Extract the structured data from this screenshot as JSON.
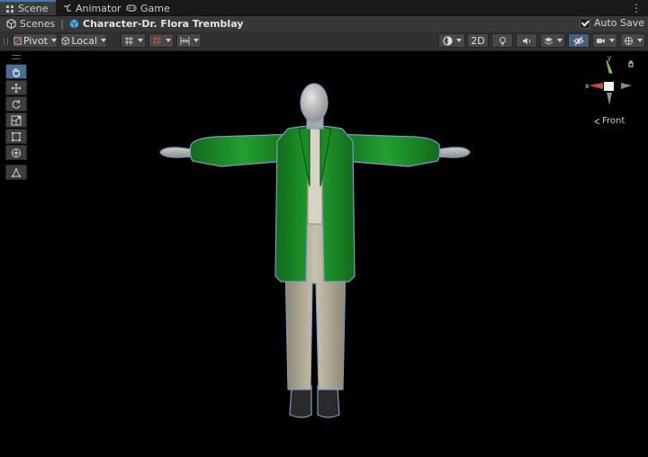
{
  "tabs": [
    {
      "label": "Scene",
      "icon": "grid-icon",
      "active": true
    },
    {
      "label": "Animator",
      "icon": "animator-icon",
      "active": false
    },
    {
      "label": "Game",
      "icon": "gamepad-icon",
      "active": false
    }
  ],
  "breadcrumb": {
    "root": "Scenes",
    "object": "Character-Dr. Flora Tremblay"
  },
  "auto_save": {
    "label": "Auto Save",
    "checked": true
  },
  "toolbar": {
    "pivot_label": "Pivot",
    "local_label": "Local",
    "mode_2d_label": "2D"
  },
  "gizmo": {
    "x_label": "x",
    "y_label": "y",
    "view_label": "Front"
  },
  "colors": {
    "accent": "#3a79bb",
    "coat": "#1f8a2a",
    "axis_x": "#d2483a",
    "axis_y": "#7ec94c"
  }
}
